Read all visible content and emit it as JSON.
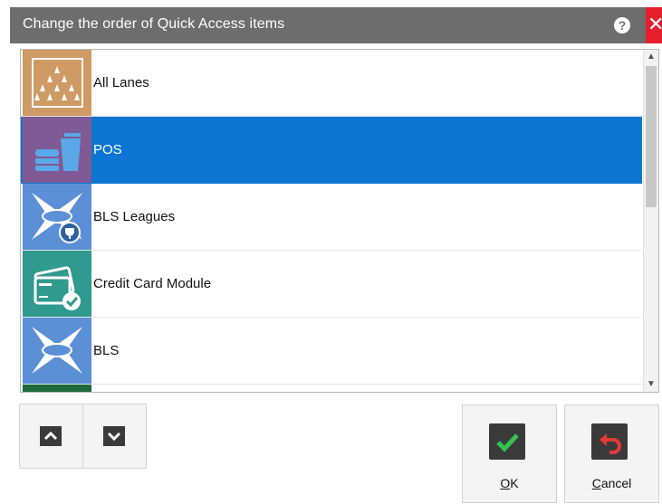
{
  "dialog": {
    "title": "Change the order of Quick Access items",
    "help_symbol": "?",
    "close_symbol": "✕"
  },
  "items": [
    {
      "label": "All Lanes",
      "icon": "bowling-pins-icon",
      "color": "#cf9a63"
    },
    {
      "label": "POS",
      "icon": "pos-food-icon",
      "color": "#7f5a94"
    },
    {
      "label": "BLS Leagues",
      "icon": "bls-leagues-icon",
      "color": "#5b8fd6"
    },
    {
      "label": "Credit Card Module",
      "icon": "credit-card-icon",
      "color": "#2f9a8d"
    },
    {
      "label": "BLS",
      "icon": "bls-icon",
      "color": "#5b8fd6"
    }
  ],
  "selected_index": 1,
  "buttons": {
    "move_up_icon": "chevron-up-icon",
    "move_down_icon": "chevron-down-icon",
    "ok_mnemonic": "O",
    "ok_rest": "K",
    "cancel_mnemonic": "C",
    "cancel_rest": "ancel"
  },
  "colors": {
    "titlebar": "#6d6d6d",
    "selection": "#0d76d2",
    "close": "#e51f2d"
  }
}
